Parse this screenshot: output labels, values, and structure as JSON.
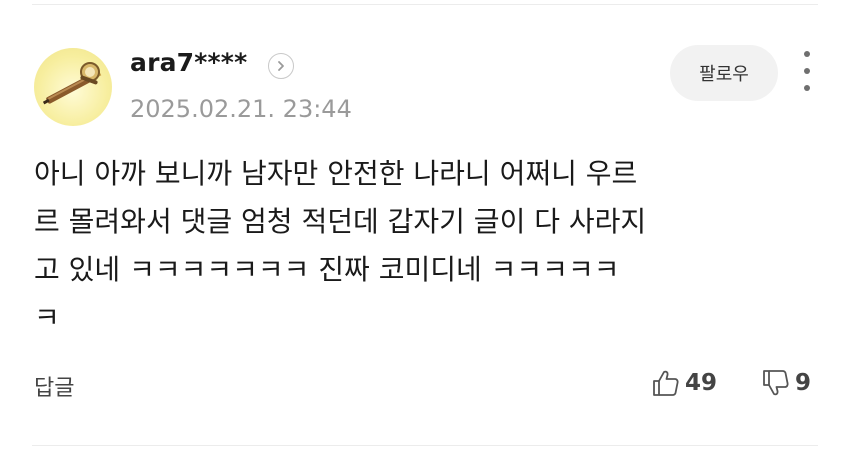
{
  "comment": {
    "username": "ara7****",
    "timestamp": "2025.02.21. 23:44",
    "follow_label": "팔로우",
    "body": "아니 아까 보니까 남자만 안전한 나라니 어쩌니 우르\n르 몰려와서 댓글 엄청 적던데 갑자기 글이 다 사라지\n고 있네 ㅋㅋㅋㅋㅋㅋㅋ 진짜 코미디네 ㅋㅋㅋㅋㅋ\nㅋ",
    "reply_label": "답글",
    "like_count": "49",
    "dislike_count": "9"
  },
  "icons": {
    "profile": "chevron-right-icon",
    "more": "more-vertical-icon",
    "like": "thumbs-up-icon",
    "dislike": "thumbs-down-icon"
  },
  "colors": {
    "timestamp": "#9a9a9a",
    "follow_bg": "#f2f2f2",
    "avatar_bg": "#f7ee9e"
  }
}
